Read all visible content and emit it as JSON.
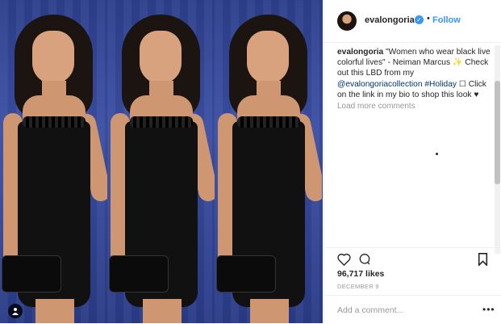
{
  "post": {
    "username": "evalongoria",
    "dot": "•",
    "follow_label": "Follow",
    "caption": {
      "user": "evalongoria",
      "text_1": " \"Women who wear black live colorful lives\" - Neiman Marcus ✨ Check out this LBD from my ",
      "mention": "@evalongoriacollection",
      "hashtag": " #Holiday",
      "text_2": " ☐ Click on the link in my bio to shop this look ♥"
    },
    "load_more": "Load more comments",
    "likes": "96,717 likes",
    "date": "DECEMBER 9",
    "add_comment_placeholder": "Add a comment...",
    "more_label": "•••"
  },
  "colors": {
    "accent": "#3897f0",
    "image_bg": "#2d3f8c"
  },
  "icons": {
    "like": "heart-icon",
    "comment": "comment-icon",
    "save": "bookmark-icon",
    "tag": "person-tag-icon",
    "verified": "verified-badge-icon"
  }
}
